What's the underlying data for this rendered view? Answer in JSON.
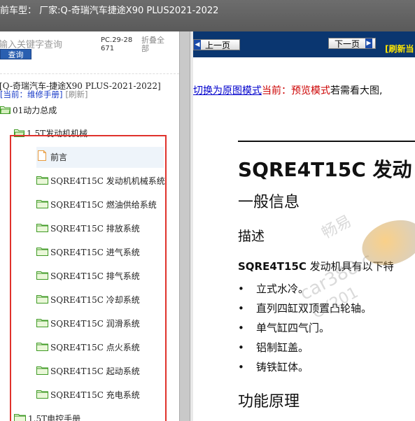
{
  "header": {
    "title": "前车型：  厂家:Q-奇瑞汽车捷途X90 PLUS2021-2022"
  },
  "left_pane": {
    "search_placeholder": "输入关键字查询",
    "query_button": "查询",
    "pc_code": "PC.29-28671",
    "collapse_all": "折叠全部",
    "tree_title": "[Q-奇瑞汽车-捷途X90 PLUS-2021-2022]",
    "current_label": "[当前：维修手册]",
    "refresh_label": "[刷新]",
    "tree": [
      {
        "label": "01动力总成",
        "level": 0,
        "icon": "folder-open-icon"
      },
      {
        "label": "1.5T发动机机械",
        "level": 1,
        "icon": "folder-open-icon"
      },
      {
        "label": "前言",
        "level": 2,
        "icon": "document-icon",
        "selected": true
      },
      {
        "label": "SQRE4T15C 发动机机械系统",
        "level": 2,
        "icon": "folder-icon"
      },
      {
        "label": "SQRE4T15C 燃油供给系统",
        "level": 2,
        "icon": "folder-icon"
      },
      {
        "label": "SQRE4T15C 排放系统",
        "level": 2,
        "icon": "folder-icon"
      },
      {
        "label": "SQRE4T15C 进气系统",
        "level": 2,
        "icon": "folder-icon"
      },
      {
        "label": "SQRE4T15C 排气系统",
        "level": 2,
        "icon": "folder-icon"
      },
      {
        "label": "SQRE4T15C 冷却系统",
        "level": 2,
        "icon": "folder-icon"
      },
      {
        "label": "SQRE4T15C 润滑系统",
        "level": 2,
        "icon": "folder-icon"
      },
      {
        "label": "SQRE4T15C 点火系统",
        "level": 2,
        "icon": "folder-icon"
      },
      {
        "label": "SQRE4T15C 起动系统",
        "level": 2,
        "icon": "folder-icon"
      },
      {
        "label": "SQRE4T15C 充电系统",
        "level": 2,
        "icon": "folder-icon"
      },
      {
        "label": "1.5T电控手册",
        "level": 1,
        "icon": "folder-icon"
      }
    ]
  },
  "right_pane": {
    "prev_button": "上一页",
    "next_button": "下一页",
    "refresh": "[刷新当",
    "switch_link": "切换为原图模式",
    "current_mode": "当前：预览模式",
    "hint": "若需看大图,",
    "doc": {
      "title": "SQRE4T15C 发动",
      "section": "一般信息",
      "subsection": "描述",
      "lead_bold": "SQRE4T15C",
      "lead_rest": " 发动机具有以下特",
      "bullets": [
        "立式水冷。",
        "直列四缸双顶置凸轮轴。",
        "单气缸四气门。",
        "铝制缸盖。",
        "铸铁缸体。"
      ],
      "heading2": "功能原理"
    },
    "watermark": {
      "text1": "畅易",
      "text2": "car388.c",
      "text3": "CY201"
    }
  },
  "colors": {
    "nav_bg": "#0a3670",
    "highlight_box": "#e0322c",
    "link": "#0000cc",
    "current_mode": "#cc0000",
    "refresh_text": "#ffe600"
  }
}
